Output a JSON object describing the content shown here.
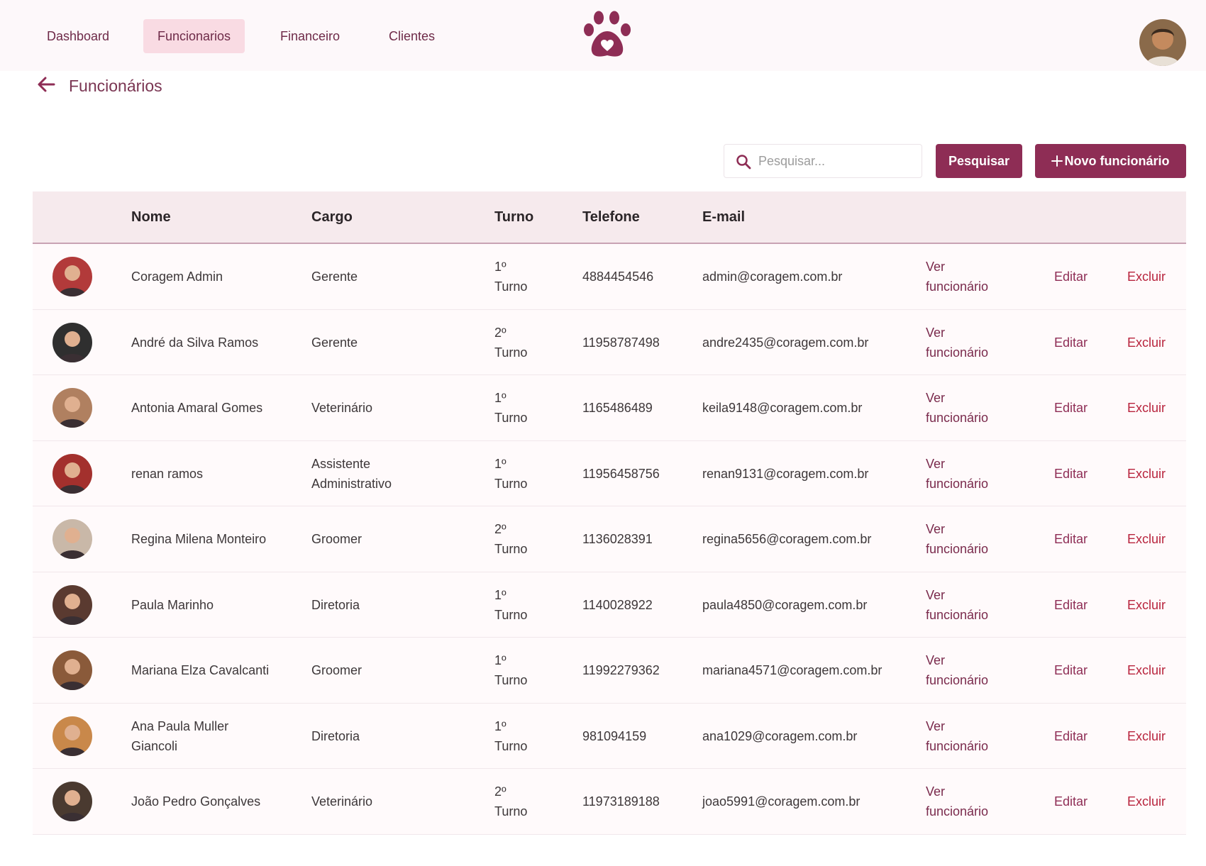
{
  "nav": [
    {
      "label": "Dashboard",
      "active": false
    },
    {
      "label": "Funcionarios",
      "active": true
    },
    {
      "label": "Financeiro",
      "active": false
    },
    {
      "label": "Clientes",
      "active": false
    }
  ],
  "page_title": "Funcionários",
  "search": {
    "placeholder": "Pesquisar...",
    "button_label": "Pesquisar"
  },
  "new_button_label": "Novo funcionário",
  "columns": [
    "Nome",
    "Cargo",
    "Turno",
    "Telefone",
    "E-mail"
  ],
  "actions": {
    "view_line1": "Ver",
    "view_line2": "funcionário",
    "edit": "Editar",
    "delete": "Excluir"
  },
  "employees": [
    {
      "name_lines": [
        "Coragem Admin"
      ],
      "cargo_lines": [
        "Gerente"
      ],
      "turno_lines": [
        "1º",
        "Turno"
      ],
      "telefone": "4884454546",
      "email": "admin@coragem.com.br",
      "avatar_color": "#b23a3a"
    },
    {
      "name_lines": [
        "André da Silva Ramos"
      ],
      "cargo_lines": [
        "Gerente"
      ],
      "turno_lines": [
        "2º",
        "Turno"
      ],
      "telefone": "11958787498",
      "email": "andre2435@coragem.com.br",
      "avatar_color": "#2f2f2f"
    },
    {
      "name_lines": [
        "Antonia Amaral Gomes"
      ],
      "cargo_lines": [
        "Veterinário"
      ],
      "turno_lines": [
        "1º",
        "Turno"
      ],
      "telefone": "1165486489",
      "email": "keila9148@coragem.com.br",
      "avatar_color": "#b08060"
    },
    {
      "name_lines": [
        "renan ramos"
      ],
      "cargo_lines": [
        "Assistente",
        "Administrativo"
      ],
      "turno_lines": [
        "1º",
        "Turno"
      ],
      "telefone": "11956458756",
      "email": "renan9131@coragem.com.br",
      "avatar_color": "#a3302d"
    },
    {
      "name_lines": [
        "Regina Milena Monteiro"
      ],
      "cargo_lines": [
        "Groomer"
      ],
      "turno_lines": [
        "2º",
        "Turno"
      ],
      "telefone": "1136028391",
      "email": "regina5656@coragem.com.br",
      "avatar_color": "#c9b8a8"
    },
    {
      "name_lines": [
        "Paula Marinho"
      ],
      "cargo_lines": [
        "Diretoria"
      ],
      "turno_lines": [
        "1º",
        "Turno"
      ],
      "telefone": "1140028922",
      "email": "paula4850@coragem.com.br",
      "avatar_color": "#5a3a30"
    },
    {
      "name_lines": [
        "Mariana Elza Cavalcanti"
      ],
      "cargo_lines": [
        "Groomer"
      ],
      "turno_lines": [
        "1º",
        "Turno"
      ],
      "telefone": "11992279362",
      "email": "mariana4571@coragem.com.br",
      "avatar_color": "#8a5a3a"
    },
    {
      "name_lines": [
        "Ana Paula Muller",
        "Giancoli"
      ],
      "cargo_lines": [
        "Diretoria"
      ],
      "turno_lines": [
        "1º",
        "Turno"
      ],
      "telefone": "981094159",
      "email": "ana1029@coragem.com.br",
      "avatar_color": "#c9884a"
    },
    {
      "name_lines": [
        "João Pedro Gonçalves"
      ],
      "cargo_lines": [
        "Veterinário"
      ],
      "turno_lines": [
        "2º",
        "Turno"
      ],
      "telefone": "11973189188",
      "email": "joao5991@coragem.com.br",
      "avatar_color": "#4a3a30"
    }
  ],
  "colors": {
    "brand": "#8e2d55",
    "nav_active_bg": "#f9dbe3",
    "delete": "#b8243d",
    "header_bg": "#f6eaed"
  },
  "icons": {
    "back": "arrow-left-icon",
    "search": "search-icon",
    "add": "plus-icon",
    "logo": "paw-heart-icon"
  }
}
